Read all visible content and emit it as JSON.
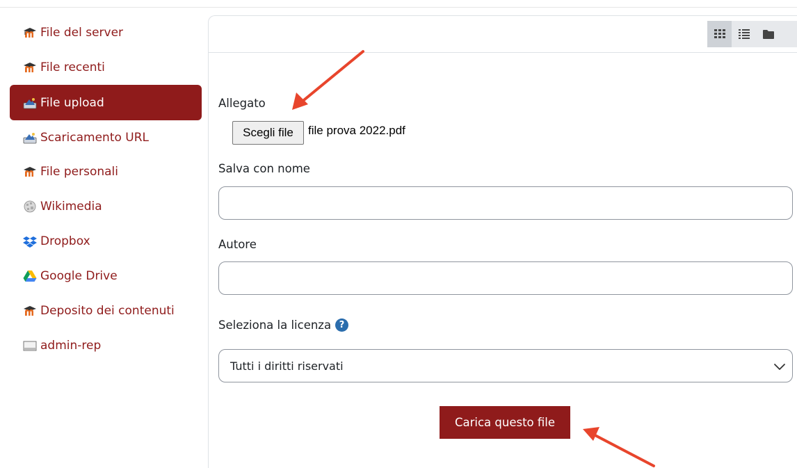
{
  "sidebar": {
    "items": [
      {
        "label": "File del server",
        "icon": "moodle-hat-icon",
        "active": false
      },
      {
        "label": "File recenti",
        "icon": "moodle-hat-icon",
        "active": false
      },
      {
        "label": "File upload",
        "icon": "upload-icon",
        "active": true
      },
      {
        "label": "Scaricamento URL",
        "icon": "download-url-icon",
        "active": false
      },
      {
        "label": "File personali",
        "icon": "moodle-hat-icon",
        "active": false
      },
      {
        "label": "Wikimedia",
        "icon": "wikimedia-globe-icon",
        "active": false
      },
      {
        "label": "Dropbox",
        "icon": "dropbox-icon",
        "active": false
      },
      {
        "label": "Google Drive",
        "icon": "google-drive-icon",
        "active": false
      },
      {
        "label": "Deposito dei contenuti",
        "icon": "moodle-hat-icon",
        "active": false
      },
      {
        "label": "admin-rep",
        "icon": "folder-repo-icon",
        "active": false
      }
    ]
  },
  "toolbar": {
    "views": [
      {
        "icon": "grid-view-icon",
        "active": true
      },
      {
        "icon": "list-view-icon",
        "active": false
      },
      {
        "icon": "folder-view-icon",
        "active": false
      }
    ]
  },
  "form": {
    "attachment_label": "Allegato",
    "choose_file_label": "Scegli file",
    "chosen_file": "file prova 2022.pdf",
    "save_as_label": "Salva con nome",
    "save_as_value": "",
    "author_label": "Autore",
    "author_value": "",
    "license_label": "Seleziona la licenza",
    "help_icon_glyph": "?",
    "license_selected": "Tutti i diritti riservati",
    "upload_button": "Carica questo file"
  },
  "colors": {
    "accent": "#8f1b1b",
    "annotation_arrow": "#e8452c",
    "help_icon": "#2b6dad"
  }
}
